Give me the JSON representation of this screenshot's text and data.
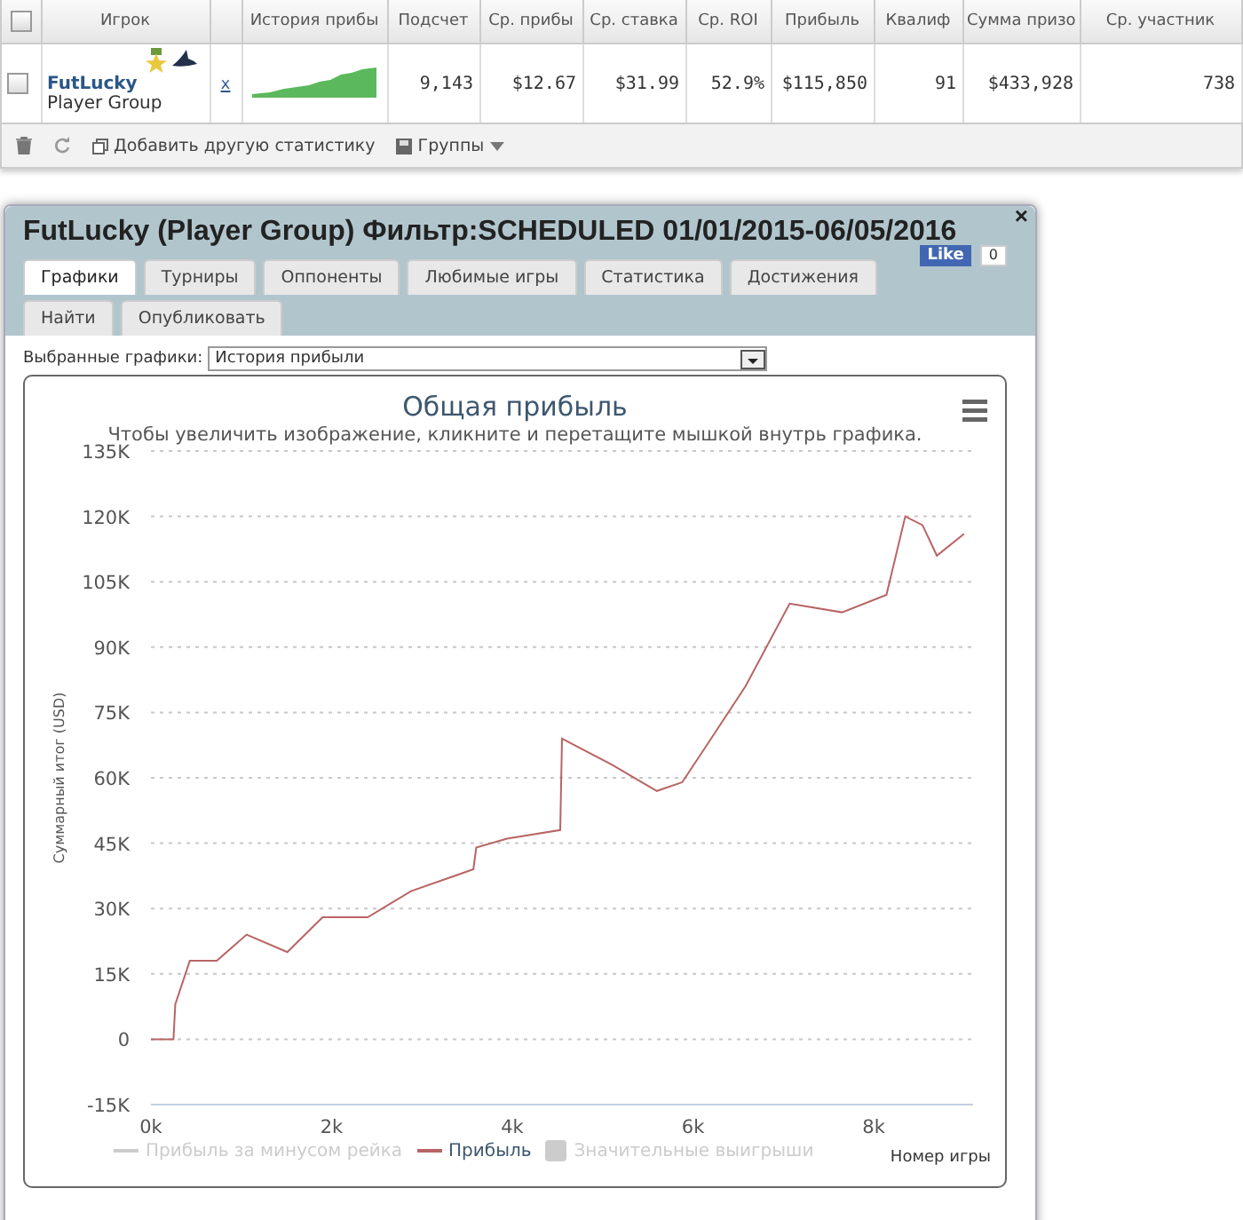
{
  "table": {
    "all_checked": false,
    "columns": [
      "Игрок",
      "",
      "История прибы",
      "Подсчет",
      "Ср. прибы",
      "Ср. ставка",
      "Ср. ROI",
      "Прибыль",
      "Квалиф",
      "Сумма призо",
      "Ср. участник"
    ],
    "rows": [
      {
        "checked": false,
        "player": "FutLucky",
        "group": "Player Group",
        "remove": "x",
        "count": "9,143",
        "avg_profit": "$12.67",
        "avg_stake": "$31.99",
        "avg_roi": "52.9%",
        "profit": "$115,850",
        "qualif": "91",
        "prize_sum": "$433,928",
        "avg_entrants": "738"
      }
    ]
  },
  "toolbar": {
    "add_stat": "Добавить другую статистику",
    "groups": "Группы"
  },
  "dialog": {
    "title": "FutLucky (Player Group) Фильтр:SCHEDULED 01/01/2015-06/05/2016",
    "close": "×",
    "like": {
      "label": "Like",
      "count": "0"
    },
    "tabs": [
      {
        "label": "Графики",
        "selected": true
      },
      {
        "label": "Турниры",
        "selected": false
      },
      {
        "label": "Оппоненты",
        "selected": false
      },
      {
        "label": "Любимые игры",
        "selected": false
      },
      {
        "label": "Статистика",
        "selected": false
      },
      {
        "label": "Достижения",
        "selected": false
      },
      {
        "label": "Найти",
        "selected": false
      },
      {
        "label": "Опубликовать",
        "selected": false
      }
    ],
    "chart_select": {
      "label": "Выбранные графики:",
      "value": "История прибыли"
    },
    "chart": {
      "subtitle": "Чтобы увеличить изображение, кликните и перетащите мышкой внутрь графика.",
      "legend": [
        {
          "label": "Прибыль за минусом рейка",
          "visible": false,
          "kind": "line"
        },
        {
          "visible": true,
          "kind": "series"
        },
        {
          "label": "Значительные выигрыши",
          "visible": false,
          "kind": "box"
        }
      ],
      "chart_data": {
        "type": "line",
        "grid": true,
        "title": "Общая прибыль",
        "xlabel": "Номер игры",
        "ylabel": "Суммарный итог (USD)",
        "xlim": [
          0,
          9100
        ],
        "ylim": [
          -15000,
          135000
        ],
        "xticks": [
          {
            "value": 0,
            "label": "0k"
          },
          {
            "value": 2000,
            "label": "2k"
          },
          {
            "value": 4000,
            "label": "4k"
          },
          {
            "value": 6000,
            "label": "6k"
          },
          {
            "value": 8000,
            "label": "8k"
          }
        ],
        "yticks": [
          {
            "value": -15000,
            "label": "-15K"
          },
          {
            "value": 0,
            "label": "0"
          },
          {
            "value": 15000,
            "label": "15K"
          },
          {
            "value": 30000,
            "label": "30K"
          },
          {
            "value": 45000,
            "label": "45K"
          },
          {
            "value": 60000,
            "label": "60K"
          },
          {
            "value": 75000,
            "label": "75K"
          },
          {
            "value": 90000,
            "label": "90K"
          },
          {
            "value": 105000,
            "label": "105K"
          },
          {
            "value": 120000,
            "label": "120K"
          },
          {
            "value": 135000,
            "label": "135K"
          }
        ],
        "x": [
          0,
          250,
          270,
          430,
          730,
          1060,
          1510,
          1900,
          2400,
          2880,
          3570,
          3600,
          3940,
          4530,
          4550,
          5100,
          5600,
          5880,
          6200,
          6580,
          7070,
          7650,
          8140,
          8350,
          8540,
          8700,
          9000
        ],
        "series": [
          {
            "name": "Прибыль",
            "color": "#b86464",
            "values": [
              0,
              0,
              8000,
              18000,
              18000,
              24000,
              20000,
              28000,
              28000,
              34000,
              39000,
              44000,
              46000,
              48000,
              69000,
              63000,
              57000,
              59000,
              69000,
              81000,
              100000,
              98000,
              102000,
              120000,
              118000,
              111000,
              116000
            ]
          }
        ]
      }
    }
  }
}
